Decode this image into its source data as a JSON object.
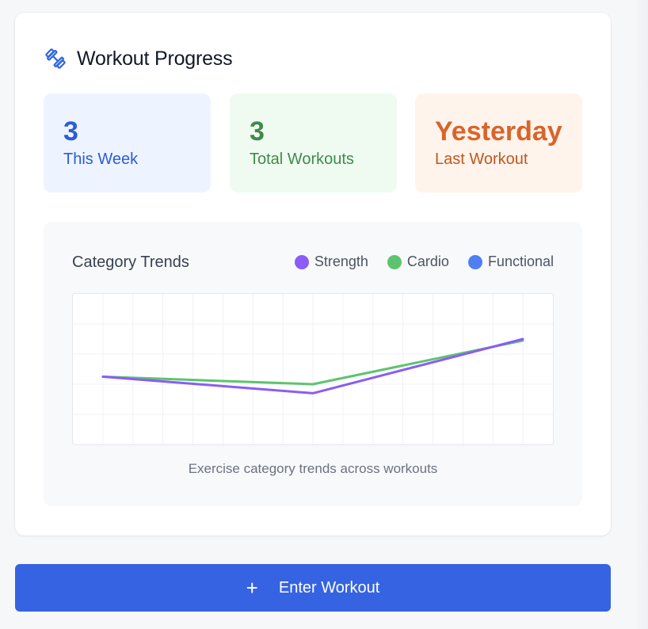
{
  "header": {
    "title": "Workout Progress",
    "icon": "dumbbell-icon",
    "icon_color": "#2f67e0"
  },
  "stats": [
    {
      "value": "3",
      "label": "This Week",
      "color": "#2d5bd8"
    },
    {
      "value": "3",
      "label": "Total Workouts",
      "color": "#3f8a4a"
    },
    {
      "value": "Yesterday",
      "label": "Last Workout",
      "color": "#d9642b"
    }
  ],
  "trends": {
    "title": "Category Trends",
    "caption": "Exercise category trends across workouts",
    "legend": [
      {
        "label": "Strength",
        "color": "#8b5cf6"
      },
      {
        "label": "Cardio",
        "color": "#5cc46f"
      },
      {
        "label": "Functional",
        "color": "#4f7ff0"
      }
    ]
  },
  "chart_data": {
    "type": "line",
    "title": "Category Trends",
    "xlabel": "",
    "ylabel": "",
    "grid": true,
    "x": [
      1,
      2,
      3
    ],
    "ylim": [
      0,
      5
    ],
    "series": [
      {
        "name": "Strength",
        "color": "#8b5cf6",
        "values": [
          2.25,
          1.7,
          3.5
        ]
      },
      {
        "name": "Cardio",
        "color": "#5cc46f",
        "values": [
          2.25,
          2.0,
          3.45
        ]
      }
    ]
  },
  "actions": {
    "enter_label": "Enter Workout",
    "enter_icon": "plus-icon"
  }
}
